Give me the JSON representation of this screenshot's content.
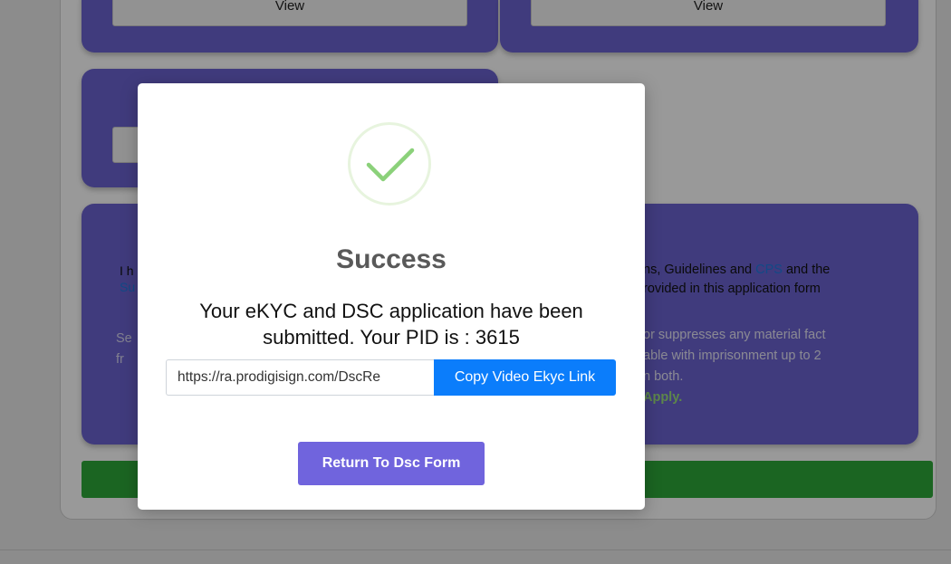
{
  "background": {
    "cards": [
      {
        "button_label": "View"
      },
      {
        "button_label": "View"
      }
    ],
    "declaration": {
      "left_line1": "I h",
      "left_line2": "Su",
      "right_line1_pre": "ns, Guidelines and ",
      "right_line1_link": "CPS",
      "right_line1_post": " and the",
      "right_line2": "rovided in this application form",
      "warn_left_line1": "Se",
      "warn_left_line2": "fr",
      "warn_right_line1": " or suppresses any material fact",
      "warn_right_line2": "able with imprisonment up to 2",
      "warn_right_line3": "n both.",
      "apply_text": "Apply."
    }
  },
  "dialog": {
    "icon": "checkmark-icon",
    "title": "Success",
    "message": "Your eKYC and DSC application have been submitted. Your PID is : 3615",
    "link_value": "https://ra.prodigisign.com/DscRe",
    "copy_button_label": "Copy Video Ekyc Link",
    "return_button_label": "Return To Dsc Form"
  },
  "colors": {
    "card": "#6c63d1",
    "success_green": "#8bd17a",
    "copy_button": "#0b7dfb",
    "return_button": "#7064dd",
    "submit_bar": "#2ea83a"
  }
}
